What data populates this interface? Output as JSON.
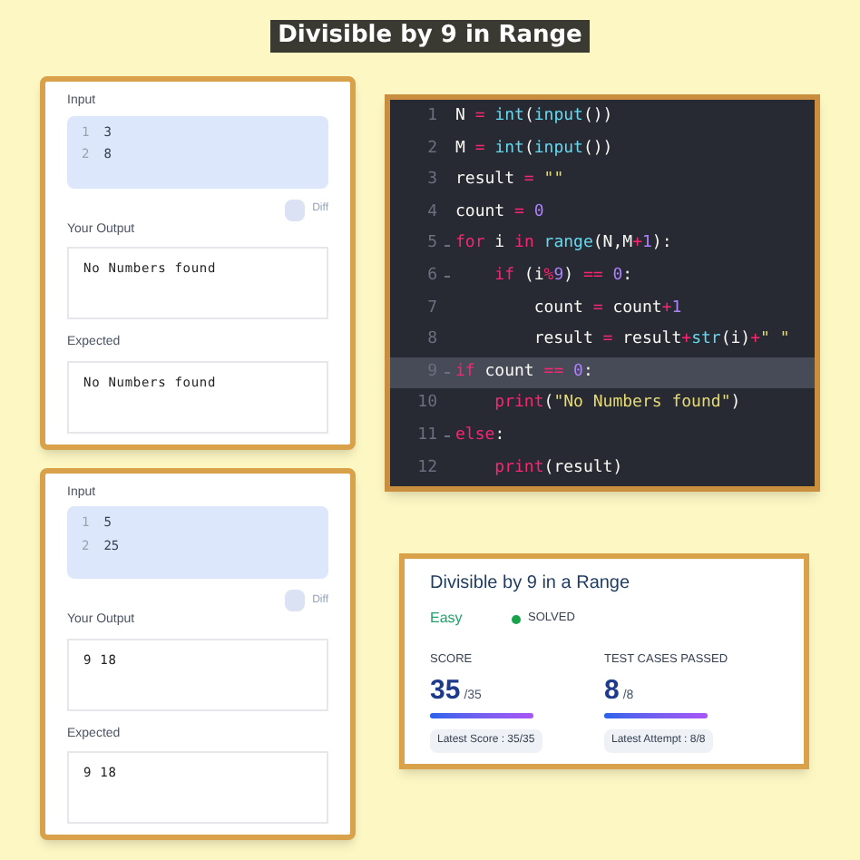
{
  "title": "Divisible by 9 in Range",
  "test_panels": [
    {
      "input_label": "Input",
      "input_lines": [
        {
          "number": "1",
          "text": "3"
        },
        {
          "number": "2",
          "text": "8"
        }
      ],
      "diff_label": "Diff",
      "output_label": "Your Output",
      "output": "No Numbers found",
      "expected_label": "Expected",
      "expected": "No Numbers found"
    },
    {
      "input_label": "Input",
      "input_lines": [
        {
          "number": "1",
          "text": "5"
        },
        {
          "number": "2",
          "text": "25"
        }
      ],
      "diff_label": "Diff",
      "output_label": "Your Output",
      "output": "9 18",
      "expected_label": "Expected",
      "expected": "9 18"
    }
  ],
  "code_editor": {
    "lines": [
      {
        "number": "1",
        "foldable": false,
        "active": false,
        "tokens": [
          {
            "kind": "plain",
            "text": "N"
          },
          {
            "kind": "op",
            "text": " = "
          },
          {
            "kind": "builtin",
            "text": "int"
          },
          {
            "kind": "plain",
            "text": "("
          },
          {
            "kind": "builtin",
            "text": "input"
          },
          {
            "kind": "plain",
            "text": "())"
          }
        ]
      },
      {
        "number": "2",
        "foldable": false,
        "active": false,
        "tokens": [
          {
            "kind": "plain",
            "text": "M"
          },
          {
            "kind": "op",
            "text": " = "
          },
          {
            "kind": "builtin",
            "text": "int"
          },
          {
            "kind": "plain",
            "text": "("
          },
          {
            "kind": "builtin",
            "text": "input"
          },
          {
            "kind": "plain",
            "text": "())"
          }
        ]
      },
      {
        "number": "3",
        "foldable": false,
        "active": false,
        "tokens": [
          {
            "kind": "plain",
            "text": "result"
          },
          {
            "kind": "op",
            "text": " = "
          },
          {
            "kind": "string",
            "text": "\"\""
          }
        ]
      },
      {
        "number": "4",
        "foldable": false,
        "active": false,
        "tokens": [
          {
            "kind": "plain",
            "text": "count"
          },
          {
            "kind": "op",
            "text": " = "
          },
          {
            "kind": "number",
            "text": "0"
          }
        ]
      },
      {
        "number": "5",
        "foldable": true,
        "active": false,
        "tokens": [
          {
            "kind": "keyword",
            "text": "for"
          },
          {
            "kind": "plain",
            "text": " i "
          },
          {
            "kind": "keyword",
            "text": "in"
          },
          {
            "kind": "builtin",
            "text": " range"
          },
          {
            "kind": "plain",
            "text": "(N,M"
          },
          {
            "kind": "op",
            "text": "+"
          },
          {
            "kind": "number",
            "text": "1"
          },
          {
            "kind": "plain",
            "text": "):"
          }
        ]
      },
      {
        "number": "6",
        "foldable": true,
        "active": false,
        "tokens": [
          {
            "kind": "keyword",
            "text": "    if"
          },
          {
            "kind": "plain",
            "text": " (i"
          },
          {
            "kind": "op",
            "text": "%"
          },
          {
            "kind": "number",
            "text": "9"
          },
          {
            "kind": "plain",
            "text": ") "
          },
          {
            "kind": "op",
            "text": "== "
          },
          {
            "kind": "number",
            "text": "0"
          },
          {
            "kind": "plain",
            "text": ":"
          }
        ]
      },
      {
        "number": "7",
        "foldable": false,
        "active": false,
        "tokens": [
          {
            "kind": "plain",
            "text": "        count"
          },
          {
            "kind": "op",
            "text": " = "
          },
          {
            "kind": "plain",
            "text": "count"
          },
          {
            "kind": "op",
            "text": "+"
          },
          {
            "kind": "number",
            "text": "1"
          }
        ]
      },
      {
        "number": "8",
        "foldable": false,
        "active": false,
        "tokens": [
          {
            "kind": "plain",
            "text": "        result"
          },
          {
            "kind": "op",
            "text": " = "
          },
          {
            "kind": "plain",
            "text": "result"
          },
          {
            "kind": "op",
            "text": "+"
          },
          {
            "kind": "builtin",
            "text": "str"
          },
          {
            "kind": "plain",
            "text": "(i)"
          },
          {
            "kind": "op",
            "text": "+"
          },
          {
            "kind": "string",
            "text": "\" \""
          }
        ]
      },
      {
        "number": "9",
        "foldable": true,
        "active": true,
        "tokens": [
          {
            "kind": "keyword",
            "text": "if"
          },
          {
            "kind": "plain",
            "text": " count "
          },
          {
            "kind": "op",
            "text": "== "
          },
          {
            "kind": "number",
            "text": "0"
          },
          {
            "kind": "plain",
            "text": ":"
          }
        ]
      },
      {
        "number": "10",
        "foldable": false,
        "active": false,
        "tokens": [
          {
            "kind": "keyword",
            "text": "    print"
          },
          {
            "kind": "plain",
            "text": "("
          },
          {
            "kind": "string",
            "text": "\"No Numbers found\""
          },
          {
            "kind": "plain",
            "text": ")"
          }
        ]
      },
      {
        "number": "11",
        "foldable": true,
        "active": false,
        "tokens": [
          {
            "kind": "keyword",
            "text": "else"
          },
          {
            "kind": "plain",
            "text": ":"
          }
        ]
      },
      {
        "number": "12",
        "foldable": false,
        "active": false,
        "tokens": [
          {
            "kind": "keyword",
            "text": "    print"
          },
          {
            "kind": "plain",
            "text": "(result)"
          }
        ]
      }
    ]
  },
  "problem_card": {
    "title": "Divisible by 9 in a Range",
    "difficulty": "Easy",
    "status": "SOLVED",
    "stats": [
      {
        "label": "SCORE",
        "value": "35",
        "total": "/35",
        "level": 1,
        "note": "Latest Score : 35/35"
      },
      {
        "label": "TEST CASES PASSED",
        "value": "8",
        "total": "/8",
        "level": 1,
        "note": "Latest Attempt : 8/8"
      }
    ]
  }
}
